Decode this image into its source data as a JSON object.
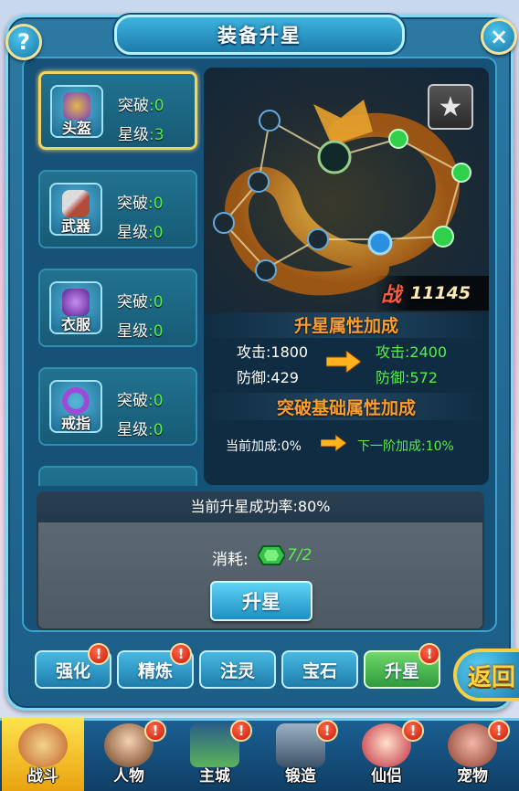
{
  "window": {
    "title": "装备升星",
    "help_icon": "?",
    "close_icon": "×"
  },
  "equipment": [
    {
      "name": "头盔",
      "break_label": "突破",
      "break_value": ":0",
      "star_label": "星级",
      "star_value": ":3",
      "selected": true,
      "color": "#7c3fbf"
    },
    {
      "name": "武器",
      "break_label": "突破",
      "break_value": ":0",
      "star_label": "星级",
      "star_value": ":0",
      "selected": false,
      "color": "#b44a3a"
    },
    {
      "name": "衣服",
      "break_label": "突破",
      "break_value": ":0",
      "star_label": "星级",
      "star_value": ":0",
      "selected": false,
      "color": "#8d3fcf"
    },
    {
      "name": "戒指",
      "break_label": "突破",
      "break_value": ":0",
      "star_label": "星级",
      "star_value": ":0",
      "selected": false,
      "color": "#9c4bd8"
    }
  ],
  "panel": {
    "battle_label": "战",
    "battle_value": "11145",
    "star_bonus_title": "升星属性加成",
    "current": {
      "attack": "攻击:1800",
      "defense": "防御:429"
    },
    "next": {
      "attack": "攻击:2400",
      "defense": "防御:572"
    },
    "break_title": "突破基础属性加成",
    "break_current": "当前加成:0%",
    "break_next": "下一阶加成:10%"
  },
  "upgrade": {
    "success_rate": "当前升星成功率:80%",
    "cost_label": "消耗:",
    "cost_value": "7/2",
    "button": "升星"
  },
  "tabs": [
    {
      "label": "强化",
      "badge": "!"
    },
    {
      "label": "精炼",
      "badge": "!"
    },
    {
      "label": "注灵",
      "badge": ""
    },
    {
      "label": "宝石",
      "badge": ""
    },
    {
      "label": "升星",
      "badge": "!",
      "active": true
    }
  ],
  "back_button": "返回",
  "nav": [
    {
      "label": "战斗",
      "badge": "",
      "active": true
    },
    {
      "label": "人物",
      "badge": "!"
    },
    {
      "label": "主城",
      "badge": "!"
    },
    {
      "label": "锻造",
      "badge": "!"
    },
    {
      "label": "仙侣",
      "badge": "!"
    },
    {
      "label": "宠物",
      "badge": "!"
    }
  ],
  "colors": {
    "accent": "#58ee4a",
    "title_orange": "#ff9d2c",
    "selected_border": "#f3d261"
  }
}
